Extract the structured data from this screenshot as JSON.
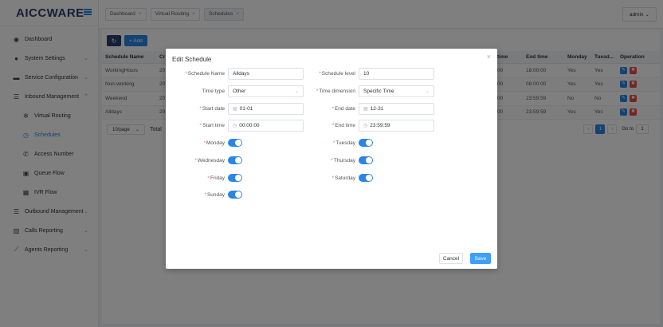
{
  "app": {
    "logo": "AICCWARE"
  },
  "sidebar": {
    "items": [
      {
        "label": "Dashboard",
        "icon": "tachometer-icon"
      },
      {
        "label": "System Settings",
        "icon": "users-icon"
      },
      {
        "label": "Service Configuration",
        "icon": "server-icon"
      },
      {
        "label": "Inbound Management",
        "icon": "list-icon"
      },
      {
        "label": "Virtual Routing",
        "icon": "gear-icon"
      },
      {
        "label": "Schedules",
        "icon": "clock-icon"
      },
      {
        "label": "Access Number",
        "icon": "phone-icon"
      },
      {
        "label": "Queue Flow",
        "icon": "queue-icon"
      },
      {
        "label": "IVR Flow",
        "icon": "grid-icon"
      },
      {
        "label": "Outbound Management",
        "icon": "list-icon"
      },
      {
        "label": "Calls Reporting",
        "icon": "bar-chart-icon"
      },
      {
        "label": "Agents Reporting",
        "icon": "line-chart-icon"
      }
    ]
  },
  "tabs": [
    {
      "label": "Dashboard"
    },
    {
      "label": "Virtual Routing"
    },
    {
      "label": "Schedules"
    }
  ],
  "user": {
    "label": "admin"
  },
  "toolbar": {
    "add_label": "+ Add"
  },
  "table": {
    "headers": {
      "name": "Schedule Name",
      "cr": "Cr",
      "time": "time",
      "end_time": "End time",
      "monday": "Monday",
      "tuesday": "Tuesd...",
      "operation": "Operation"
    },
    "rows": [
      {
        "name": "WorkingHours",
        "cr": "20",
        "time": "00",
        "end_time": "18:00:00",
        "monday": "Yes",
        "tuesday": "Yes"
      },
      {
        "name": "Non-working",
        "cr": "20",
        "time": "00",
        "end_time": "08:00:00",
        "monday": "Yes",
        "tuesday": "Yes"
      },
      {
        "name": "Weekend",
        "cr": "20",
        "time": "00",
        "end_time": "23:59:59",
        "monday": "No",
        "tuesday": "No"
      },
      {
        "name": "Alldays",
        "cr": "20",
        "time": "00",
        "end_time": "23:59:59",
        "monday": "Yes",
        "tuesday": "Yes"
      }
    ]
  },
  "pager": {
    "size_label": "10/page",
    "total_label": "Total",
    "page": "1",
    "goto_label": "Go to",
    "goto_value": "1"
  },
  "dialog": {
    "title": "Edit Schedule",
    "fields": {
      "schedule_name": {
        "label": "Schedule Name",
        "value": "Alldays"
      },
      "schedule_level": {
        "label": "Schedule level",
        "value": "10"
      },
      "time_type": {
        "label": "Time type",
        "value": "Other"
      },
      "time_dimension": {
        "label": "Time dimension",
        "value": "Specific Time"
      },
      "start_date": {
        "label": "Start date",
        "value": "01-01"
      },
      "end_date": {
        "label": "End date",
        "value": "12-31"
      },
      "start_time": {
        "label": "Start time",
        "value": "00:00:00"
      },
      "end_time": {
        "label": "End time",
        "value": "23:59:59"
      },
      "monday": {
        "label": "Monday"
      },
      "tuesday": {
        "label": "Tuesday"
      },
      "wednesday": {
        "label": "Wednesday"
      },
      "thursday": {
        "label": "Thursday"
      },
      "friday": {
        "label": "Friday"
      },
      "saturday": {
        "label": "Saturday"
      },
      "sunday": {
        "label": "Sunday"
      }
    },
    "cancel_label": "Cancel",
    "save_label": "Save"
  },
  "colors": {
    "primary": "#2b85e4",
    "navy": "#2d3e6e",
    "danger": "#e94b4b"
  }
}
